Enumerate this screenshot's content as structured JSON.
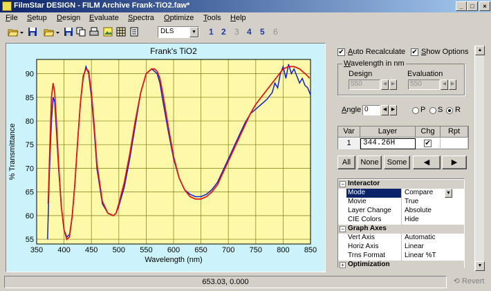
{
  "window": {
    "title": "FilmStar DESIGN - FILM Archive Frank-TiO2.faw*",
    "minimize": "_",
    "maximize": "□",
    "close": "×"
  },
  "menu": [
    {
      "label": "File",
      "u": "F",
      "rest": "ile"
    },
    {
      "label": "Setup",
      "u": "S",
      "rest": "etup"
    },
    {
      "label": "Design",
      "u": "D",
      "rest": "esign"
    },
    {
      "label": "Evaluate",
      "u": "E",
      "rest": "valuate"
    },
    {
      "label": "Spectra",
      "u": "S",
      "pre": "",
      "rest": "pectra"
    },
    {
      "label": "Optimize",
      "u": "O",
      "rest": "ptimize"
    },
    {
      "label": "Tools",
      "u": "T",
      "rest": "ools"
    },
    {
      "label": "Help",
      "u": "H",
      "rest": "elp"
    }
  ],
  "toolbar": {
    "icons": [
      "open-folder-icon",
      "save-icon",
      "open-folder-icon",
      "save-icon",
      "copy-icon",
      "print-icon",
      "picture-icon",
      "table-icon",
      "report-icon"
    ],
    "combo_value": "DLS",
    "combo_arrow": "▼",
    "numbers": [
      "1",
      "2",
      "3",
      "4",
      "5",
      "6"
    ]
  },
  "chart_data": {
    "type": "line",
    "title": "Frank's TiO2",
    "xlabel": "Wavelength (nm)",
    "ylabel": "% Transmittance",
    "xlim": [
      350,
      850
    ],
    "ylim": [
      54,
      93
    ],
    "xticks": [
      350,
      400,
      450,
      500,
      550,
      600,
      650,
      700,
      750,
      800,
      850
    ],
    "yticks": [
      55,
      60,
      65,
      70,
      75,
      80,
      85,
      90
    ],
    "grid": true,
    "series": [
      {
        "color": "#1020d0",
        "x": [
          370,
          373,
          377,
          380,
          383,
          386,
          390,
          395,
          400,
          405,
          410,
          415,
          420,
          425,
          430,
          435,
          440,
          445,
          450,
          455,
          460,
          470,
          480,
          490,
          495,
          500,
          510,
          520,
          530,
          540,
          550,
          560,
          565,
          570,
          575,
          580,
          590,
          600,
          610,
          620,
          630,
          640,
          650,
          660,
          670,
          680,
          690,
          700,
          710,
          720,
          730,
          740,
          750,
          760,
          770,
          780,
          785,
          790,
          795,
          800,
          805,
          810,
          815,
          820,
          825,
          830,
          835,
          840,
          845,
          850
        ],
        "y": [
          55,
          68,
          80,
          85,
          84,
          78,
          70,
          62,
          57,
          55.5,
          56,
          60,
          67,
          76,
          84,
          89,
          91.5,
          90,
          85,
          78,
          70,
          62.5,
          60.5,
          60,
          60.5,
          62,
          66,
          72,
          79,
          86,
          90,
          91,
          90.5,
          90,
          88,
          84.5,
          78,
          72,
          68,
          65.5,
          64.5,
          64,
          64,
          64.5,
          65.5,
          67,
          69.5,
          72,
          74.5,
          77,
          79.5,
          81.5,
          82.5,
          83.5,
          84.5,
          86,
          88,
          87,
          90,
          91.5,
          89,
          92,
          90,
          91,
          89.5,
          88,
          89,
          87.5,
          87,
          85.5
        ]
      },
      {
        "color": "#e01818",
        "x": [
          371,
          374,
          377,
          380,
          383,
          386,
          390,
          395,
          400,
          405,
          410,
          415,
          420,
          425,
          430,
          435,
          440,
          445,
          450,
          455,
          460,
          470,
          480,
          490,
          495,
          500,
          510,
          520,
          530,
          540,
          550,
          560,
          565,
          570,
          575,
          580,
          590,
          600,
          610,
          620,
          630,
          640,
          650,
          660,
          670,
          680,
          690,
          700,
          710,
          720,
          730,
          740,
          750,
          760,
          770,
          780,
          790,
          800,
          810,
          820,
          830,
          840,
          845,
          848
        ],
        "y": [
          62.5,
          74,
          85,
          88,
          86,
          80,
          71,
          62,
          57,
          55,
          55.5,
          60,
          67,
          76,
          84,
          89.5,
          91,
          90.5,
          86,
          79,
          71,
          63,
          60.5,
          60,
          60.5,
          62.5,
          67,
          73,
          80,
          86,
          90,
          91,
          91,
          90.5,
          89,
          86,
          79,
          72.5,
          68,
          65.5,
          64,
          63.5,
          63.5,
          64,
          65,
          66.5,
          69,
          71.5,
          74,
          76.5,
          79,
          81.5,
          83.5,
          85,
          86.5,
          88,
          89.5,
          91,
          91.5,
          91.5,
          91,
          90,
          89.5,
          89
        ]
      }
    ]
  },
  "panel": {
    "auto_recalc": {
      "label": "Auto Recalculate",
      "u": "A",
      "rest": "uto Recalculate",
      "checked": "✔"
    },
    "show_options": {
      "label": "Show Options",
      "u": "S",
      "rest": "how Options",
      "checked": "✔"
    },
    "wavelength_group": "Wavelength in nm",
    "wavelength_group_u": "W",
    "wavelength_group_rest": "avelength in nm",
    "design_label": "Design",
    "design_value": "550",
    "evaluation_label": "Evaluation",
    "evaluation_value": "550",
    "angle_label": "Angle",
    "angle_u": "A",
    "angle_rest": "ngle",
    "angle_value": "0",
    "pol": [
      {
        "label": "P",
        "on": false
      },
      {
        "label": "S",
        "on": false
      },
      {
        "label": "R",
        "on": true
      }
    ],
    "grid_headers": [
      "Var",
      "Layer",
      "Chg",
      "Rpt"
    ],
    "grid_row": {
      "var": "1",
      "layer": "344.26H",
      "chg": "✔",
      "rpt": ""
    },
    "buttons": {
      "all": "All",
      "none": "None",
      "some": "Some",
      "prev": "◀",
      "next": "▶"
    },
    "properties": [
      {
        "cat": true,
        "key": "Interactor",
        "exp": "−"
      },
      {
        "key": "Mode",
        "value": "Compare",
        "sel": true
      },
      {
        "key": "Movie",
        "value": "True"
      },
      {
        "key": "Layer Change",
        "value": "Absolute"
      },
      {
        "key": "CIE Colors",
        "value": "Hide"
      },
      {
        "cat": true,
        "key": "Graph Axes",
        "exp": "−"
      },
      {
        "key": "Vert Axis",
        "value": "Automatic"
      },
      {
        "key": "Horiz Axis",
        "value": "Linear"
      },
      {
        "key": "Trns Format",
        "value": "Linear %T"
      },
      {
        "cat": true,
        "key": "Optimization",
        "exp": "+"
      }
    ]
  },
  "status": {
    "coords": "653.03, 0.000",
    "revert": "Revert"
  }
}
